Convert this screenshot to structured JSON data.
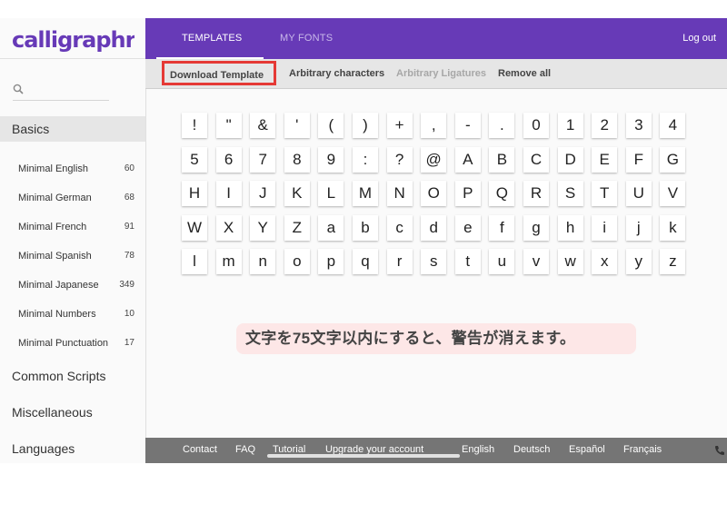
{
  "app": {
    "logo_text": "calligraphr"
  },
  "nav": {
    "tabs": [
      {
        "label": "TEMPLATES"
      },
      {
        "label": "MY FONTS"
      }
    ],
    "logout_label": "Log out"
  },
  "toolbar": {
    "download_label": "Download Template",
    "arbitrary_chars_label": "Arbitrary characters",
    "arbitrary_ligatures_label": "Arbitrary Ligatures",
    "remove_all_label": "Remove all"
  },
  "search": {
    "placeholder": ""
  },
  "sidebar": {
    "sections": [
      {
        "label": "Basics"
      },
      {
        "label": "Common Scripts"
      },
      {
        "label": "Miscellaneous"
      },
      {
        "label": "Languages"
      }
    ],
    "basics_items": [
      {
        "label": "Minimal English",
        "count": "60"
      },
      {
        "label": "Minimal German",
        "count": "68"
      },
      {
        "label": "Minimal French",
        "count": "91"
      },
      {
        "label": "Minimal Spanish",
        "count": "78"
      },
      {
        "label": "Minimal Japanese",
        "count": "349"
      },
      {
        "label": "Minimal Numbers",
        "count": "10"
      },
      {
        "label": "Minimal Punctuation",
        "count": "17"
      }
    ]
  },
  "glyphs": [
    [
      "!",
      "\"",
      "&",
      "'",
      "(",
      ")",
      "+",
      ",",
      "-",
      ".",
      "0",
      "1",
      "2",
      "3",
      "4"
    ],
    [
      "5",
      "6",
      "7",
      "8",
      "9",
      ":",
      "?",
      "@",
      "A",
      "B",
      "C",
      "D",
      "E",
      "F",
      "G"
    ],
    [
      "H",
      "I",
      "J",
      "K",
      "L",
      "M",
      "N",
      "O",
      "P",
      "Q",
      "R",
      "S",
      "T",
      "U",
      "V"
    ],
    [
      "W",
      "X",
      "Y",
      "Z",
      "a",
      "b",
      "c",
      "d",
      "e",
      "f",
      "g",
      "h",
      "i",
      "j",
      "k"
    ],
    [
      "l",
      "m",
      "n",
      "o",
      "p",
      "q",
      "r",
      "s",
      "t",
      "u",
      "v",
      "w",
      "x",
      "y",
      "z"
    ]
  ],
  "warning_text": "文字を75文字以内にすると、警告が消えます。",
  "footer": {
    "links": [
      {
        "label": "Contact"
      },
      {
        "label": "FAQ"
      },
      {
        "label": "Tutorial"
      },
      {
        "label": "Upgrade your account"
      },
      {
        "label": "English"
      },
      {
        "label": "Deutsch"
      },
      {
        "label": "Español"
      },
      {
        "label": "Français"
      }
    ]
  },
  "colors": {
    "primary": "#673ab7",
    "highlight_border": "#e53935",
    "warning_bg": "#fde7e7",
    "footer_bg": "#757575"
  }
}
